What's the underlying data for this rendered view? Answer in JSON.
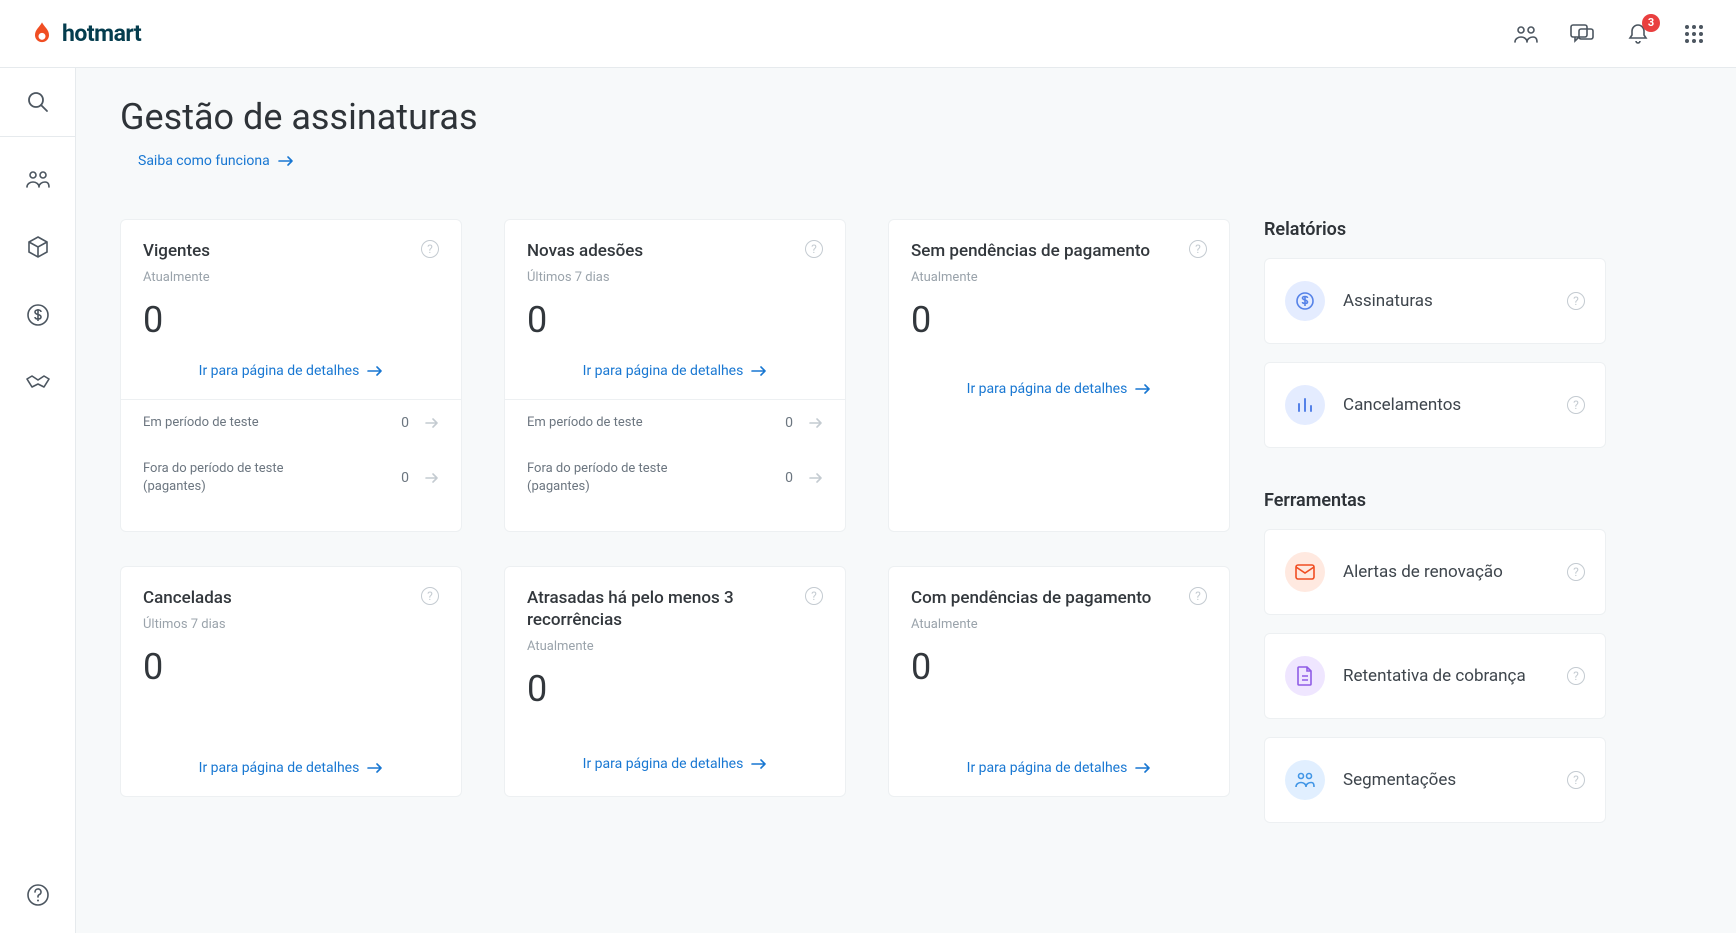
{
  "brand": {
    "name": "hotmart"
  },
  "notifications": {
    "count": "3"
  },
  "page": {
    "title": "Gestão de assinaturas",
    "learn_more": "Saiba como funciona"
  },
  "cards": {
    "details_link": "Ir para página de detalhes",
    "vigentes": {
      "title": "Vigentes",
      "sub": "Atualmente",
      "value": "0",
      "breakdown": {
        "trial_label": "Em período de teste",
        "trial_value": "0",
        "paying_label": "Fora do período de teste (pagantes)",
        "paying_value": "0"
      }
    },
    "novas": {
      "title": "Novas adesões",
      "sub": "Últimos 7 dias",
      "value": "0",
      "breakdown": {
        "trial_label": "Em período de teste",
        "trial_value": "0",
        "paying_label": "Fora do período de teste (pagantes)",
        "paying_value": "0"
      }
    },
    "sem_pendencias": {
      "title": "Sem pendências de pagamento",
      "sub": "Atualmente",
      "value": "0"
    },
    "canceladas": {
      "title": "Canceladas",
      "sub": "Últimos 7 dias",
      "value": "0"
    },
    "atrasadas": {
      "title": "Atrasadas há pelo menos 3 recorrências",
      "sub": "Atualmente",
      "value": "0"
    },
    "com_pendencias": {
      "title": "Com pendências de pagamento",
      "sub": "Atualmente",
      "value": "0"
    }
  },
  "reports": {
    "title": "Relatórios",
    "items": [
      {
        "label": "Assinaturas"
      },
      {
        "label": "Cancelamentos"
      }
    ]
  },
  "tools": {
    "title": "Ferramentas",
    "items": [
      {
        "label": "Alertas de renovação"
      },
      {
        "label": "Retentativa de cobrança"
      },
      {
        "label": "Segmentações"
      }
    ]
  }
}
